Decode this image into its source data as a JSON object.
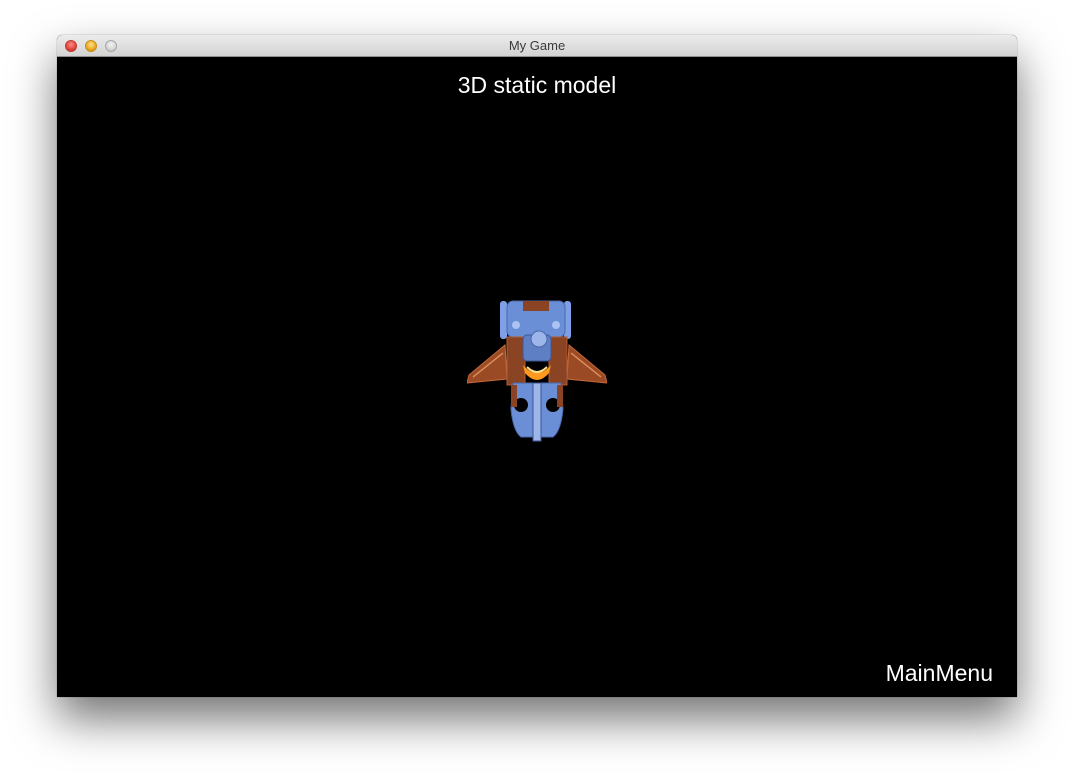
{
  "window": {
    "title": "My Game"
  },
  "scene": {
    "title": "3D static model",
    "model": "spaceship",
    "menu_label": "MainMenu"
  },
  "colors": {
    "background": "#000000",
    "text": "#ffffff",
    "ship_blue": "#6b8fd6",
    "ship_copper": "#9a4a25",
    "ship_glow": "#ff9a1f"
  }
}
